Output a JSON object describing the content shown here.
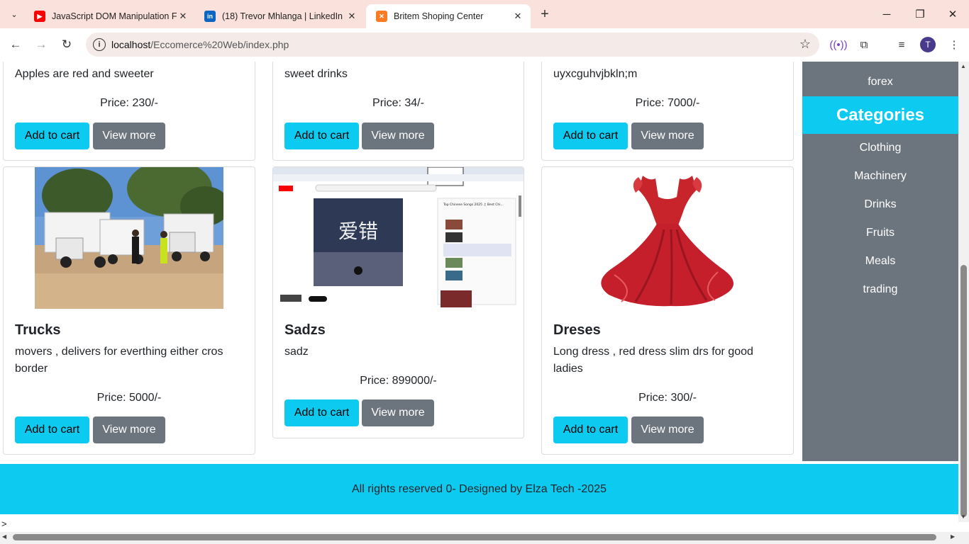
{
  "browser": {
    "tabs": [
      {
        "title": "JavaScript DOM Manipulation F",
        "icon": "youtube-icon"
      },
      {
        "title": "(18) Trevor Mhlanga | LinkedIn",
        "icon": "linkedin-icon"
      },
      {
        "title": "Britem Shoping Center",
        "icon": "xampp-icon"
      }
    ],
    "url_host": "localhost",
    "url_path": "/Eccomerce%20Web/index.php",
    "profile_initial": "T"
  },
  "products_row1": [
    {
      "desc": "Apples are red and sweeter",
      "price": "Price: 230/-"
    },
    {
      "desc": "sweet drinks",
      "price": "Price: 34/-"
    },
    {
      "desc": "uyxcguhvjbkln;m",
      "price": "Price: 7000/-"
    }
  ],
  "products_row2": [
    {
      "name": "Trucks",
      "desc": "movers , delivers for everthing either cros border",
      "price": "Price: 5000/-"
    },
    {
      "name": "Sadzs",
      "desc": "sadz",
      "price": "Price: 899000/-"
    },
    {
      "name": "Dreses",
      "desc": "Long dress , red dress slim drs for good ladies",
      "price": "Price: 300/-"
    }
  ],
  "buttons": {
    "add_to_cart": "Add to cart",
    "view_more": "View more"
  },
  "sidebar": {
    "top_item": "forex",
    "heading": "Categories",
    "categories": [
      "Clothing",
      "Machinery",
      "Drinks",
      "Fruits",
      "Meals",
      "trading"
    ]
  },
  "screenshot_text": {
    "song_title": "爱错",
    "playlist_title": "Top Chinese Songs 2025 ♫ Best Chi..."
  },
  "footer": {
    "text": "All rights reserved 0- Designed by Elza Tech -2025"
  },
  "stray_text": ">",
  "colors": {
    "accent": "#0dcaf0",
    "secondary": "#6c757d",
    "tabbar": "#fbe1dc"
  }
}
